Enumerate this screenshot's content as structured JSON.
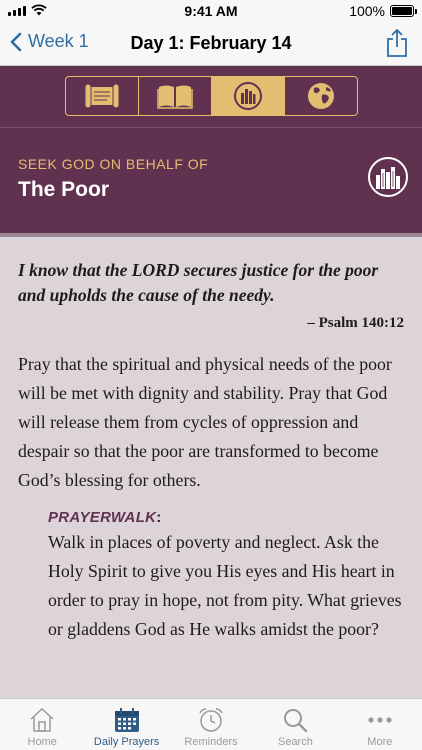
{
  "status_bar": {
    "time": "9:41 AM",
    "battery": "100%"
  },
  "nav": {
    "back_label": "Week 1",
    "title": "Day 1: February 14"
  },
  "segments": [
    {
      "name": "scroll",
      "active": false
    },
    {
      "name": "book",
      "active": false
    },
    {
      "name": "city",
      "active": true
    },
    {
      "name": "globe",
      "active": false
    }
  ],
  "header": {
    "kicker": "SEEK GOD ON BEHALF OF",
    "title": "The Poor"
  },
  "content": {
    "verse": "I know that the LORD secures justice for the poor and upholds the cause of the needy.",
    "reference": "– Psalm 140:12",
    "body": "Pray that the spiritual and physical needs of the poor will be met with dignity and stability. Pray that God will release them from cycles of oppression and despair so that the poor are transformed to become God’s blessing for others.",
    "prayerwalk_label": "PRAYERWALK",
    "prayerwalk_colon": ":",
    "prayerwalk_text": "Walk in places of poverty and neglect. Ask the Holy Spirit to give you His eyes and His heart in order to pray in hope, not from pity. What grieves or gladdens God as He walks amidst the poor?"
  },
  "tabs": [
    {
      "label": "Home",
      "icon": "home-icon",
      "active": false
    },
    {
      "label": "Daily Prayers",
      "icon": "calendar-icon",
      "active": true
    },
    {
      "label": "Reminders",
      "icon": "alarm-clock-icon",
      "active": false
    },
    {
      "label": "Search",
      "icon": "search-icon",
      "active": false
    },
    {
      "label": "More",
      "icon": "more-icon",
      "active": false
    }
  ],
  "colors": {
    "brand": "#60324f",
    "accent": "#e3be70",
    "link": "#2f6ea3",
    "background": "#ddd4da"
  }
}
